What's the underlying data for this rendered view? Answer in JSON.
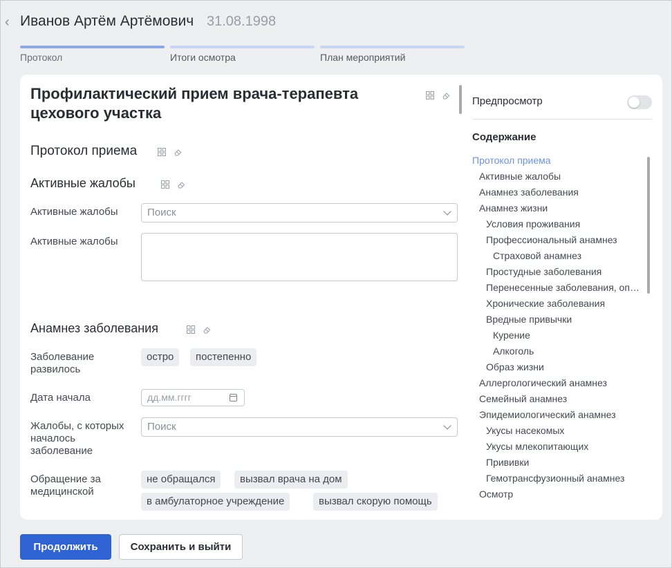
{
  "header": {
    "patient_name": "Иванов Артём Артёмович",
    "dob": "31.08.1998",
    "steps": [
      {
        "label": "Протокол"
      },
      {
        "label": "Итоги осмотра"
      },
      {
        "label": "План мероприятий"
      }
    ]
  },
  "document": {
    "title": "Профилактический прием врача-терапевта цехового участка",
    "sections": {
      "protocol": "Протокол приема",
      "complaints": "Активные жалобы",
      "anamnesis": "Анамнез заболевания"
    },
    "fields": {
      "complaints_select_label": "Активные жалобы",
      "complaints_select_placeholder": "Поиск",
      "complaints_text_label": "Активные жалобы",
      "onset_label": "Заболевание развилось",
      "onset_options": [
        "остро",
        "постепенно"
      ],
      "start_date_label": "Дата начала",
      "start_date_placeholder": "дд.мм.гггг",
      "onset_complaints_label": "Жалобы, с которых началось заболевание",
      "onset_complaints_placeholder": "Поиск",
      "appeal_label": "Обращение за медицинской",
      "appeal_options": [
        "не обращался",
        "вызвал врача на дом",
        "в амбулаторное учреждение",
        "вызвал скорую помощь"
      ]
    }
  },
  "sidebar": {
    "preview_label": "Предпросмотр",
    "preview_enabled": false,
    "toc_title": "Содержание",
    "toc": [
      {
        "label": "Протокол приема",
        "level": 0,
        "current": true
      },
      {
        "label": "Активные жалобы",
        "level": 1
      },
      {
        "label": "Анамнез заболевания",
        "level": 1
      },
      {
        "label": "Анамнез жизни",
        "level": 1
      },
      {
        "label": "Условия проживания",
        "level": 2
      },
      {
        "label": "Профессиональный анамнез",
        "level": 2
      },
      {
        "label": "Страховой анамнез",
        "level": 3
      },
      {
        "label": "Простудные заболевания",
        "level": 2
      },
      {
        "label": "Перенесенные заболевания, операции",
        "level": 2
      },
      {
        "label": "Хронические заболевания",
        "level": 2
      },
      {
        "label": "Вредные привычки",
        "level": 2
      },
      {
        "label": "Курение",
        "level": 3
      },
      {
        "label": "Алкоголь",
        "level": 3
      },
      {
        "label": "Образ жизни",
        "level": 2
      },
      {
        "label": "Аллергологический анамнез",
        "level": 1
      },
      {
        "label": "Семейный анамнез",
        "level": 1
      },
      {
        "label": "Эпидемиологический анамнез",
        "level": 1
      },
      {
        "label": "Укусы насекомых",
        "level": 2
      },
      {
        "label": "Укусы млекопитающих",
        "level": 2
      },
      {
        "label": "Прививки",
        "level": 2
      },
      {
        "label": "Гемотрансфузионный анамнез",
        "level": 2
      },
      {
        "label": "Осмотр",
        "level": 1
      }
    ]
  },
  "footer": {
    "continue_label": "Продолжить",
    "save_exit_label": "Сохранить и выйти"
  },
  "colors": {
    "accent": "#2f62d3",
    "toc_current": "#6e93dc",
    "step_active": "#8aa9e6",
    "step_inactive": "#c6d6f3"
  }
}
